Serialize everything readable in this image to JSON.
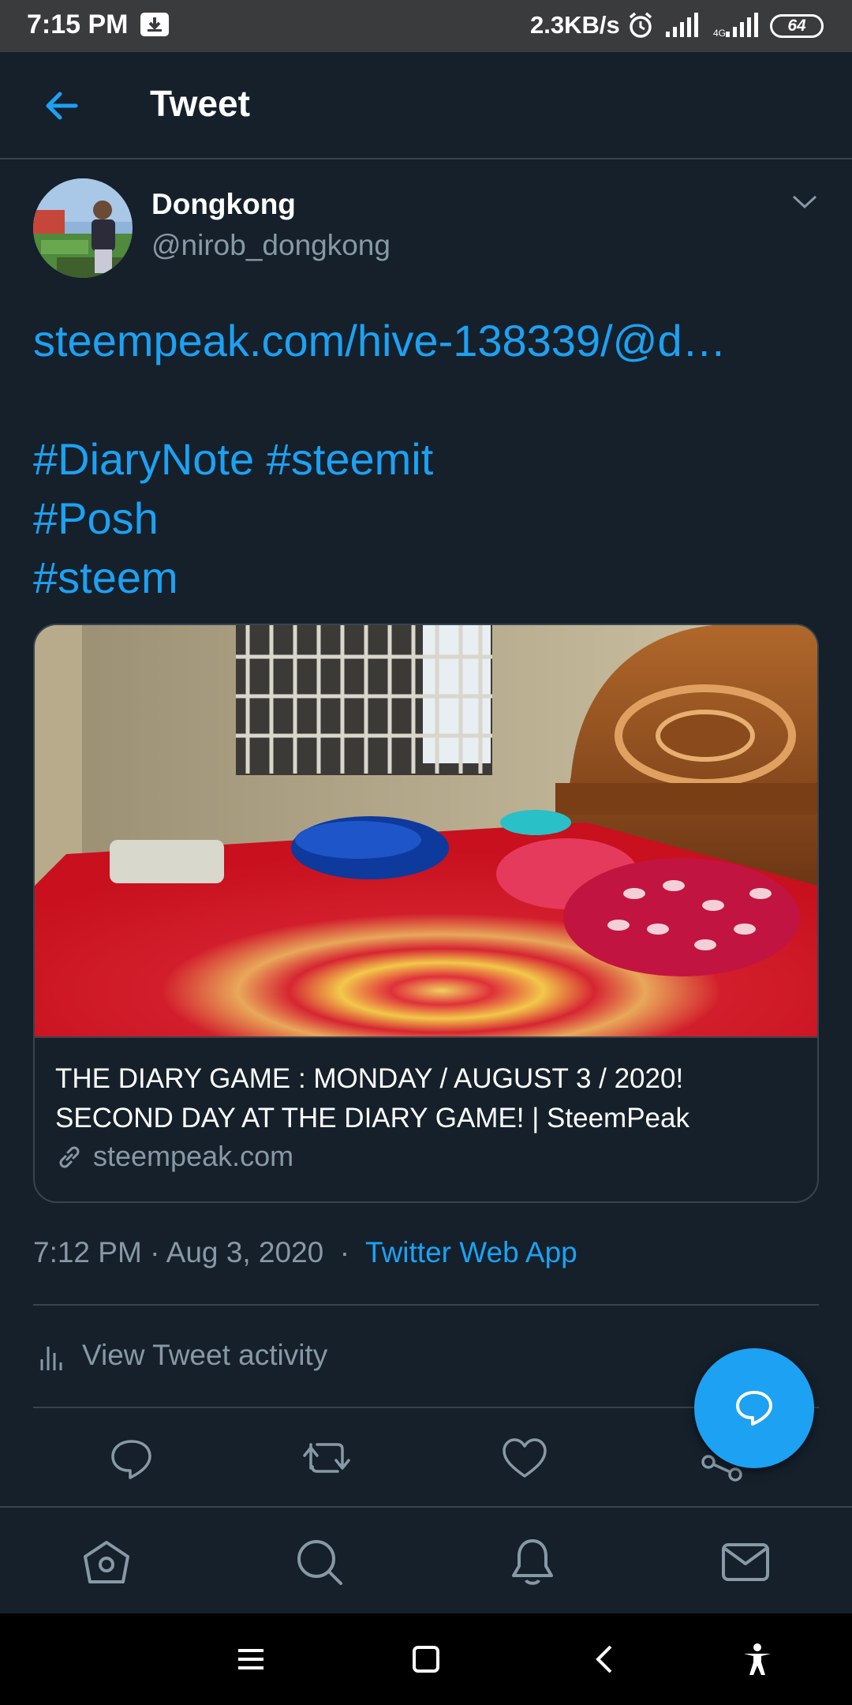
{
  "status_bar": {
    "time": "7:15 PM",
    "speed": "2.3KB/s",
    "battery": "64",
    "icons": [
      "download-icon",
      "alarm-icon",
      "signal-icon",
      "signal-icon"
    ]
  },
  "header": {
    "title": "Tweet",
    "back_icon": "arrow-left-icon"
  },
  "tweet": {
    "display_name": "Dongkong",
    "handle": "@nirob_dongkong",
    "link": "steempeak.com/hive-138339/@d…",
    "hashtag_line1": "#DiaryNote #steemit",
    "hashtag_line2": "#Posh",
    "hashtag_line3": "#steem",
    "card": {
      "title_line1": "THE DIARY GAME : MONDAY / AUGUST 3 / 2020!",
      "title_line2": "SECOND DAY AT THE DIARY GAME! | SteemPeak",
      "domain": "steempeak.com"
    },
    "time": "7:12 PM",
    "date": "Aug 3, 2020",
    "separator": "·",
    "source": "Twitter Web App",
    "activity_label": "View Tweet activity"
  },
  "actions": [
    "reply-icon",
    "retweet-icon",
    "like-icon",
    "share-icon"
  ],
  "bottom_nav": [
    "home-icon",
    "search-icon",
    "notifications-icon",
    "messages-icon"
  ],
  "system_nav": [
    "menu-icon",
    "home-square-icon",
    "back-chevron-icon",
    "accessibility-icon"
  ],
  "colors": {
    "background": "#15202b",
    "accent": "#1da1f2",
    "secondary_text": "#8899a6",
    "divider": "#38444d"
  }
}
